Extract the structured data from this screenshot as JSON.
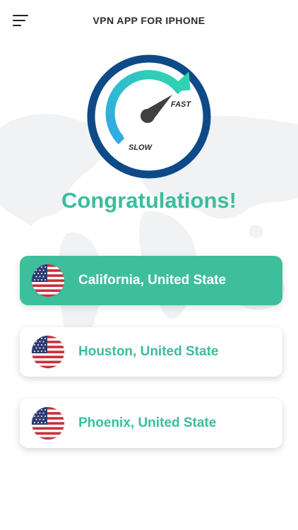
{
  "header": {
    "title": "VPN APP FOR IPHONE",
    "menu_icon": "hamburger-menu-icon"
  },
  "speedometer": {
    "fast_label": "FAST",
    "slow_label": "SLOW",
    "colors": {
      "ring": "#0f4a88",
      "arc_start": "#2fa8e6",
      "arc_end": "#2fd5b0",
      "needle": "#404040"
    }
  },
  "status": {
    "message": "Congratulations!"
  },
  "servers": [
    {
      "label": "California, United State",
      "flag_icon": "us-flag-icon",
      "selected": true
    },
    {
      "label": "Houston, United State",
      "flag_icon": "us-flag-icon",
      "selected": false
    },
    {
      "label": "Phoenix, United State",
      "flag_icon": "us-flag-icon",
      "selected": false
    }
  ],
  "colors": {
    "accent": "#3dbf9c",
    "text_dark": "#2b2b2b",
    "map": "#f1f2f3"
  }
}
